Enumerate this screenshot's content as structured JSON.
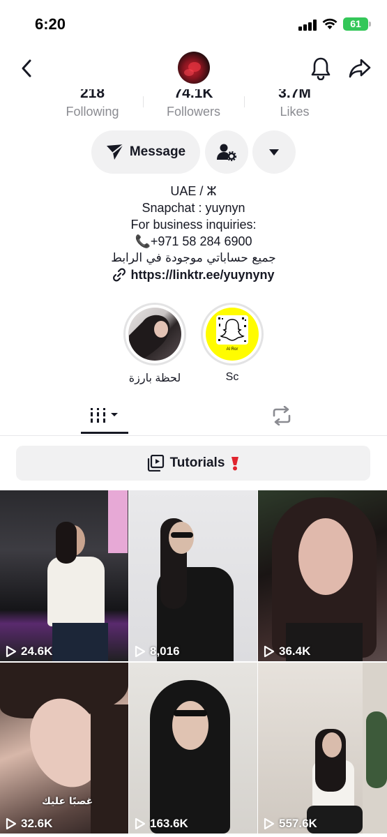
{
  "status_bar": {
    "time": "6:20",
    "battery": "61"
  },
  "profile": {
    "stats": [
      {
        "value": "218",
        "label": "Following"
      },
      {
        "value": "74.1K",
        "label": "Followers"
      },
      {
        "value": "3.7M",
        "label": "Likes"
      }
    ],
    "message_label": "Message",
    "bio": [
      "UAE / ⵣ",
      "Snapchat : yuynyn",
      "For business inquiries:",
      "📞+971 58 284 6900",
      "جميع حساباتي موجودة في الرابط"
    ],
    "link": "https://linktr.ee/yuynyny"
  },
  "highlights": [
    {
      "label": "لحظة بارزة"
    },
    {
      "label": "Sc",
      "snapcode_text": "Al Ror"
    }
  ],
  "tutorials_label": "Tutorials",
  "videos": [
    {
      "views": "24.6K"
    },
    {
      "views": "8,016"
    },
    {
      "views": "36.4K"
    },
    {
      "views": "32.6K",
      "caption": "غصبًا عليك"
    },
    {
      "views": "163.6K"
    },
    {
      "views": "557.6K"
    }
  ]
}
